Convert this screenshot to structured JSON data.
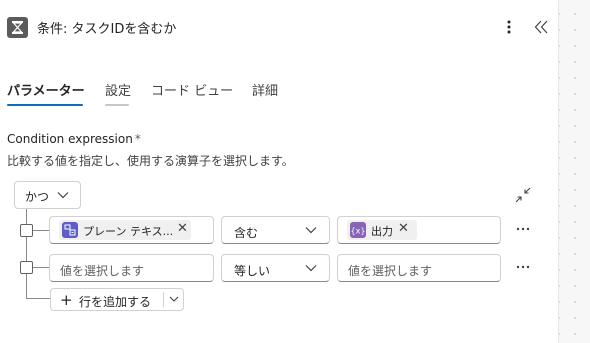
{
  "header": {
    "title": "条件: タスクIDを含むか",
    "icon": "condition-action-icon",
    "more_icon": "more-vertical-icon",
    "collapse_icon": "double-chevron-left-icon"
  },
  "tabs": [
    {
      "label": "パラメーター",
      "active": true
    },
    {
      "label": "設定",
      "active": false
    },
    {
      "label": "コード ビュー",
      "active": false
    },
    {
      "label": "詳細",
      "active": false
    }
  ],
  "condition": {
    "label": "Condition expression",
    "required_marker": "*",
    "description": "比較する値を指定し、使用する演算子を選択します。",
    "group_operator": "かつ",
    "rows": [
      {
        "left": {
          "token_label": "プレーン テキス...",
          "token_icon": "text-variable-icon",
          "token_color": "#5b5fc7"
        },
        "operator": "含む",
        "right": {
          "token_label": "出力",
          "token_icon": "expression-icon",
          "token_color": "#8764b8"
        }
      },
      {
        "left": {
          "placeholder": "値を選択します"
        },
        "operator": "等しい",
        "right": {
          "placeholder": "値を選択します"
        }
      }
    ],
    "add_row_label": "行を追加する"
  },
  "colors": {
    "accent": "#0f6cbd",
    "token_bg": "#f0f0f0",
    "border": "#d1d1d1"
  }
}
